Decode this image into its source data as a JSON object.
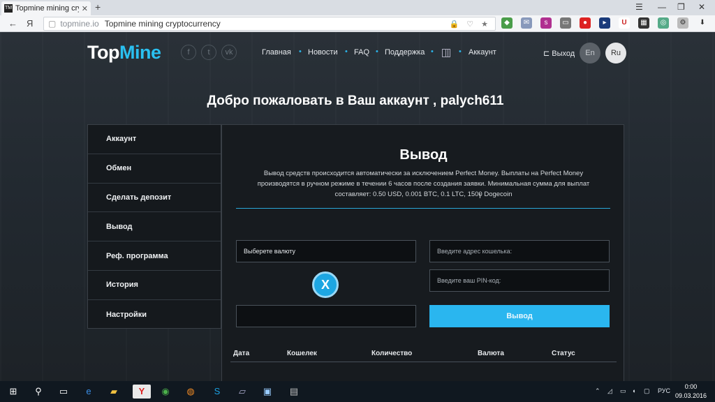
{
  "browser": {
    "tab_title": "Topmine mining crypto",
    "tab_favicon": "TM",
    "tab_close": "✕",
    "new_tab": "+",
    "url_domain": "topmine.io",
    "url_title": "Topmine mining cryptocurrency",
    "nav_yandex": "Я"
  },
  "header": {
    "logo_top": "Top",
    "logo_mine": "Mine",
    "social": [
      "f",
      "t",
      "vk"
    ],
    "nav": [
      "Главная",
      "Новости",
      "FAQ",
      "Поддержка",
      "Аккаунт"
    ],
    "logout": "⊏ Выход",
    "lang_en": "En",
    "lang_ru": "Ru"
  },
  "welcome": "Добро пожаловать в Ваш аккаунт , palych611",
  "sidebar": {
    "items": [
      {
        "label": "Аккаунт"
      },
      {
        "label": "Обмен"
      },
      {
        "label": "Сделать депозит"
      },
      {
        "label": "Вывод"
      },
      {
        "label": "Реф. программа"
      },
      {
        "label": "История"
      },
      {
        "label": "Настройки"
      }
    ]
  },
  "panel": {
    "title": "Вывод",
    "description": "Вывод средств происходится автоматически за исключением Perfect Money. Выплаты на Perfect Money производятся в ручном режиме в течении 6 часов после создания заявки. Минимальная сумма для выплат составляет: 0.50 USD, 0.001 BTC, 0.1 LTC, 1500 Dogecoin",
    "currency_select": "Выберете валюту",
    "wallet_placeholder": "Введите адрес кошелька:",
    "pin_placeholder": "Введите ваш PIN-код:",
    "withdraw_button": "Вывод",
    "close_icon": "X",
    "table_headers": [
      "Дата",
      "Кошелек",
      "Количество",
      "Валюта",
      "Статус"
    ]
  },
  "taskbar": {
    "lang": "РУС",
    "time": "0:00",
    "date": "09.03.2016"
  }
}
